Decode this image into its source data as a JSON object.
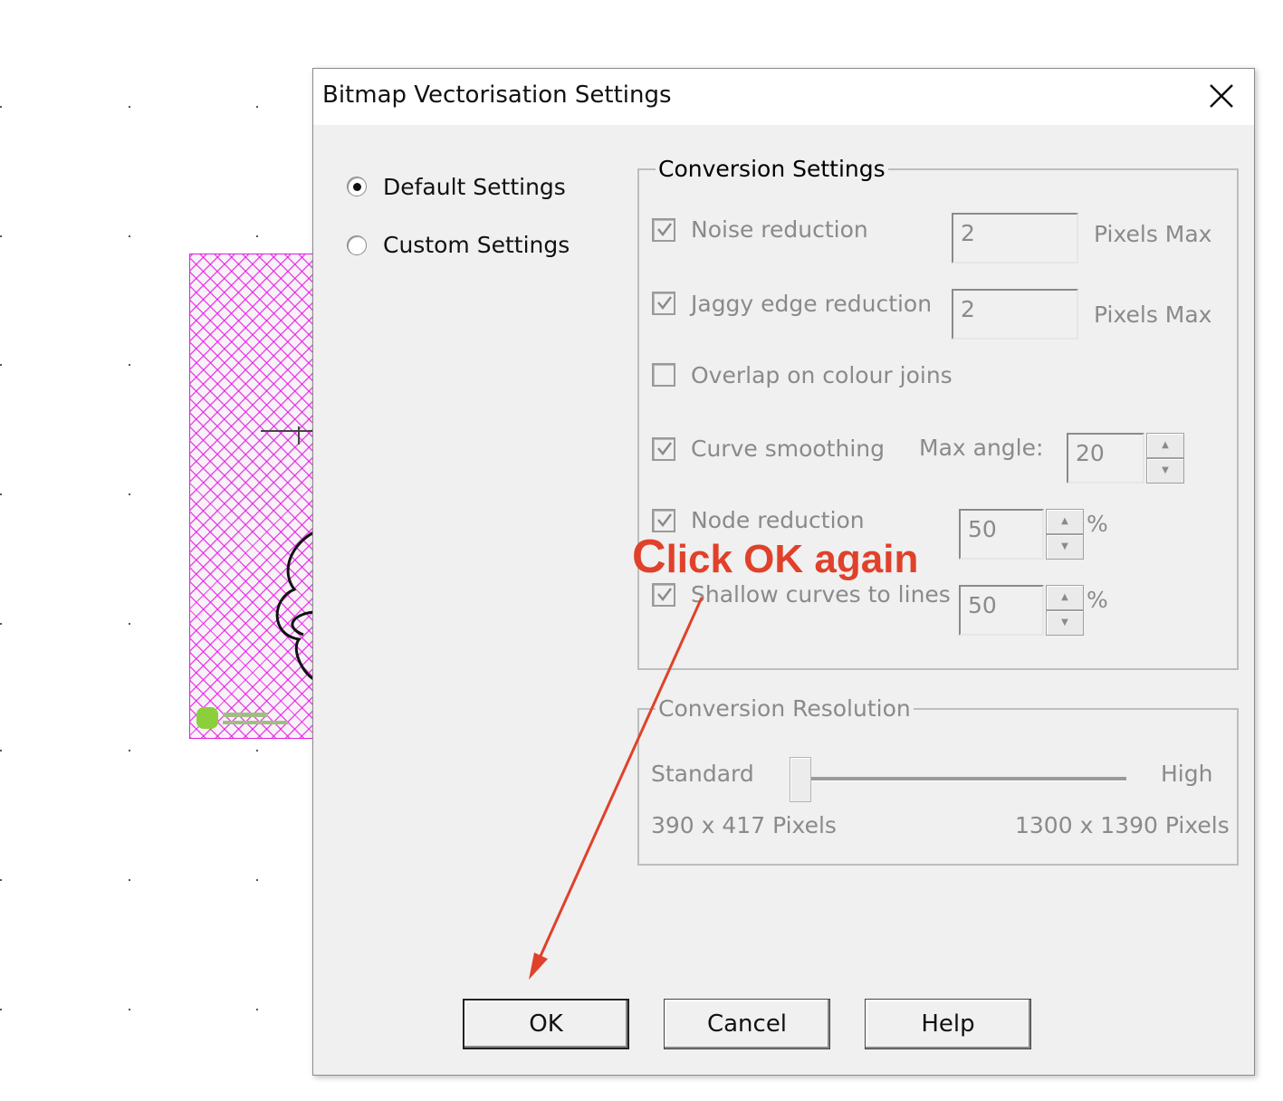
{
  "dialog": {
    "title": "Bitmap Vectorisation Settings"
  },
  "mode": {
    "default_label": "Default Settings",
    "custom_label": "Custom Settings",
    "selected": "Default Settings"
  },
  "conversion_settings": {
    "legend": "Conversion Settings",
    "noise_reduction": {
      "label": "Noise reduction",
      "checked": true,
      "value": "2",
      "unit": "Pixels Max"
    },
    "jaggy_edge": {
      "label": "Jaggy edge reduction",
      "checked": true,
      "value": "2",
      "unit": "Pixels Max"
    },
    "overlap": {
      "label": "Overlap on colour joins",
      "checked": false
    },
    "curve_smoothing": {
      "label": "Curve smoothing",
      "checked": true,
      "angle_label": "Max angle:",
      "value": "20"
    },
    "node_reduction": {
      "label": "Node reduction",
      "checked": true,
      "value": "50",
      "unit": "%"
    },
    "shallow_curves": {
      "label": "Shallow curves to lines",
      "checked": true,
      "value": "50",
      "unit": "%"
    }
  },
  "conversion_resolution": {
    "legend": "Conversion Resolution",
    "low_label": "Standard",
    "high_label": "High",
    "low_pixels": "390 x 417 Pixels",
    "high_pixels": "1300 x 1390 Pixels",
    "slider_level": 0
  },
  "buttons": {
    "ok": "OK",
    "cancel": "Cancel",
    "help": "Help"
  },
  "annotation": {
    "text_first": "C",
    "text_rest": "lick OK again",
    "color": "#e0412a"
  },
  "colors": {
    "background_image_hatch": "#e614e6"
  }
}
